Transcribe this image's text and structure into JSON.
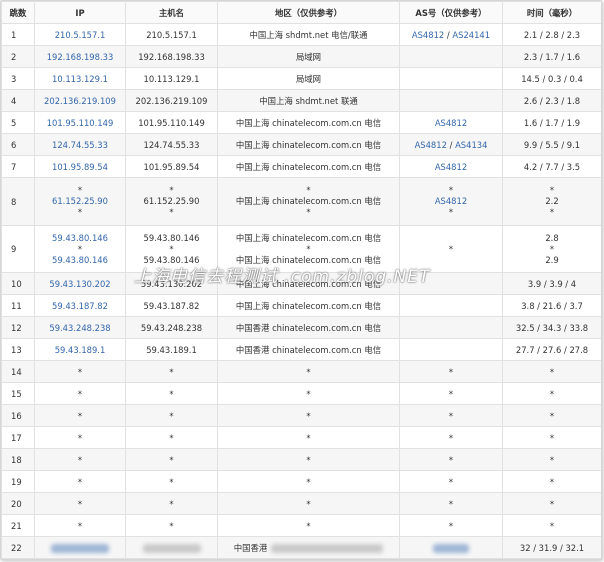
{
  "headers": [
    "跳数",
    "IP",
    "主机名",
    "地区（仅供参考）",
    "AS号（仅供参考）",
    "时间（毫秒）"
  ],
  "rows": [
    {
      "hop": "1",
      "ip": "210.5.157.1",
      "host": "210.5.157.1",
      "region": "中国上海 shdmt.net 电信/联通",
      "as": [
        "AS4812",
        "AS24141"
      ],
      "time": "2.1 / 2.8 / 2.3"
    },
    {
      "hop": "2",
      "ip": "192.168.198.33",
      "host": "192.168.198.33",
      "region": "局域网",
      "as": [],
      "time": "2.3 / 1.7 / 1.6"
    },
    {
      "hop": "3",
      "ip": "10.113.129.1",
      "host": "10.113.129.1",
      "region": "局域网",
      "as": [],
      "time": "14.5 / 0.3 / 0.4"
    },
    {
      "hop": "4",
      "ip": "202.136.219.109",
      "host": "202.136.219.109",
      "region": "中国上海 shdmt.net 联通",
      "as": [],
      "time": "2.6 / 2.3 / 1.8"
    },
    {
      "hop": "5",
      "ip": "101.95.110.149",
      "host": "101.95.110.149",
      "region": "中国上海 chinatelecom.com.cn 电信",
      "as": [
        "AS4812"
      ],
      "time": "1.6 / 1.7 / 1.9"
    },
    {
      "hop": "6",
      "ip": "124.74.55.33",
      "host": "124.74.55.33",
      "region": "中国上海 chinatelecom.com.cn 电信",
      "as": [
        "AS4812",
        "AS4134"
      ],
      "time": "9.9 / 5.5 / 9.1"
    },
    {
      "hop": "7",
      "ip": "101.95.89.54",
      "host": "101.95.89.54",
      "region": "中国上海 chinatelecom.com.cn 电信",
      "as": [
        "AS4812"
      ],
      "time": "4.2 / 7.7 / 3.5"
    },
    {
      "hop": "8",
      "ip_lines": [
        "*",
        "61.152.25.90",
        "*"
      ],
      "host_lines": [
        "*",
        "61.152.25.90",
        "*"
      ],
      "region_lines": [
        "*",
        "中国上海 chinatelecom.com.cn 电信",
        "*"
      ],
      "as_lines": [
        "*",
        "AS4812",
        "*"
      ],
      "time_lines": [
        "*",
        "2.2",
        "*"
      ]
    },
    {
      "hop": "9",
      "ip_lines": [
        "59.43.80.146",
        "*",
        "59.43.80.146"
      ],
      "host_lines": [
        "59.43.80.146",
        "*",
        "59.43.80.146"
      ],
      "region_lines": [
        "中国上海 chinatelecom.com.cn 电信",
        "*",
        "中国上海 chinatelecom.com.cn 电信"
      ],
      "as_lines": [
        "*"
      ],
      "time_lines": [
        "2.8",
        "*",
        "2.9"
      ]
    },
    {
      "hop": "10",
      "ip": "59.43.130.202",
      "host": "59.43.130.202",
      "region": "中国上海 chinatelecom.com.cn 电信",
      "as": [],
      "time": "3.9 / 3.9 / 4"
    },
    {
      "hop": "11",
      "ip": "59.43.187.82",
      "host": "59.43.187.82",
      "region": "中国上海 chinatelecom.com.cn 电信",
      "as": [],
      "time": "3.8 / 21.6 / 3.7"
    },
    {
      "hop": "12",
      "ip": "59.43.248.238",
      "host": "59.43.248.238",
      "region": "中国香港 chinatelecom.com.cn 电信",
      "as": [],
      "time": "32.5 / 34.3 / 33.8"
    },
    {
      "hop": "13",
      "ip": "59.43.189.1",
      "host": "59.43.189.1",
      "region": "中国香港 chinatelecom.com.cn 电信",
      "as": [],
      "time": "27.7 / 27.6 / 27.8"
    },
    {
      "hop": "14",
      "star": "*"
    },
    {
      "hop": "15",
      "star": "*"
    },
    {
      "hop": "16",
      "star": "*"
    },
    {
      "hop": "17",
      "star": "*"
    },
    {
      "hop": "18",
      "star": "*"
    },
    {
      "hop": "19",
      "star": "*"
    },
    {
      "hop": "20",
      "star": "*"
    },
    {
      "hop": "21",
      "star": "*"
    },
    {
      "hop": "22",
      "region_prefix": "中国香港",
      "time": "32 / 31.9 / 32.1",
      "redacted": true
    }
  ],
  "watermark": "上海电信去程测试 .com.zblog.NET"
}
